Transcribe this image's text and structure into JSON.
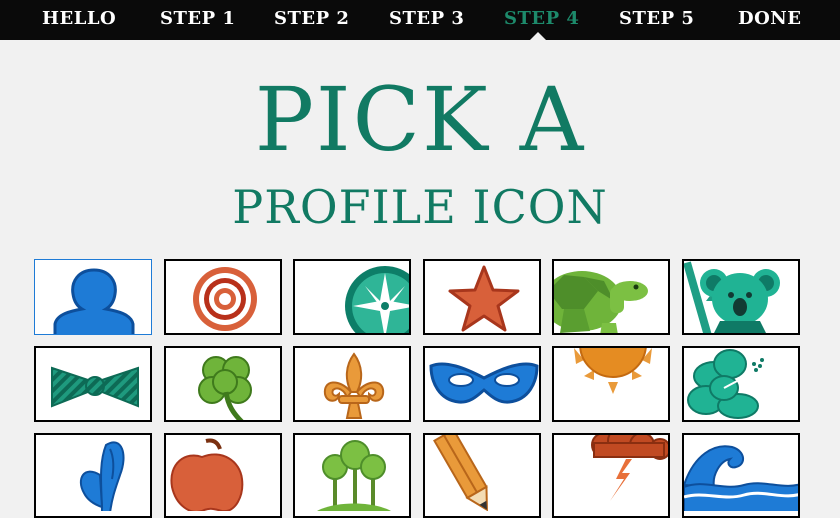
{
  "nav": {
    "items": [
      {
        "label": "HELLO",
        "active": false
      },
      {
        "label": "STEP 1",
        "active": false
      },
      {
        "label": "STEP 2",
        "active": false
      },
      {
        "label": "STEP 3",
        "active": false
      },
      {
        "label": "STEP 4",
        "active": true
      },
      {
        "label": "STEP 5",
        "active": false
      },
      {
        "label": "DONE",
        "active": false
      }
    ],
    "active_color": "#1d8a6b"
  },
  "heading": {
    "line1": "PICK A",
    "line2": "PROFILE ICON",
    "color": "#117a63"
  },
  "icons": {
    "selected": "person-icon",
    "rows": [
      [
        "person-icon",
        "target-icon",
        "compass-icon",
        "star-icon",
        "turtle-icon",
        "koala-icon"
      ],
      [
        "bowtie-icon",
        "clover-icon",
        "fleur-de-lis-icon",
        "mask-icon",
        "sun-icon",
        "hibiscus-icon"
      ],
      [
        "butterfly-icon",
        "apple-icon",
        "trees-icon",
        "pencil-icon",
        "storm-cloud-icon",
        "wave-icon"
      ]
    ]
  }
}
